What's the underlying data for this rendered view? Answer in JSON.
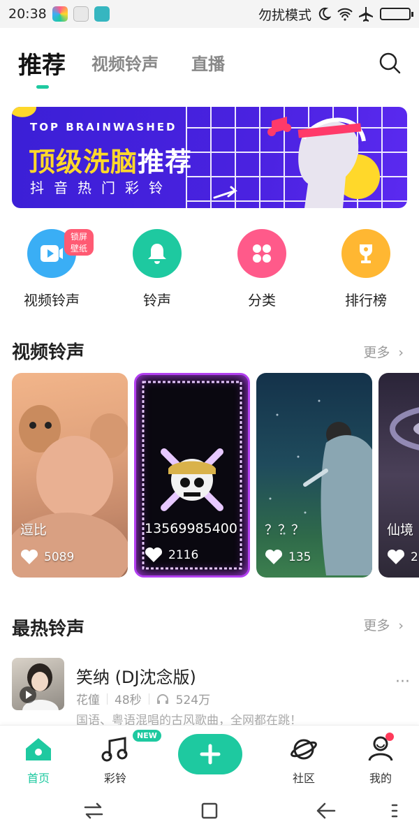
{
  "status": {
    "time": "20:38",
    "dnd_text": "勿扰模式",
    "icons": [
      "moon-icon",
      "wifi-icon",
      "airplane-icon",
      "battery-icon"
    ]
  },
  "top_tabs": [
    {
      "label": "推荐",
      "active": true
    },
    {
      "label": "视频铃声",
      "active": false
    },
    {
      "label": "直播",
      "active": false
    }
  ],
  "banner": {
    "en": "TOP BRAINWASHED",
    "title_yellow": "顶级洗脑",
    "title_white": "推荐",
    "subtitle": "抖音热门彩铃"
  },
  "quick": [
    {
      "label": "视频铃声",
      "icon": "video-play-icon",
      "color": "#3aaef5",
      "badge": "锁屏壁纸"
    },
    {
      "label": "铃声",
      "icon": "bell-icon",
      "color": "#1ec9a0"
    },
    {
      "label": "分类",
      "icon": "grid-icon",
      "color": "#ff5a8a"
    },
    {
      "label": "排行榜",
      "icon": "trophy-icon",
      "color": "#ffb732"
    }
  ],
  "video_section": {
    "title": "视频铃声",
    "more": "更多"
  },
  "videos": [
    {
      "title": "逗比",
      "likes": "5089"
    },
    {
      "title": "13569985400",
      "likes": "2116"
    },
    {
      "title": "？？？",
      "likes": "135"
    },
    {
      "title": "仙境",
      "likes": "2"
    }
  ],
  "hot_section": {
    "title": "最热铃声",
    "more": "更多"
  },
  "song": {
    "title": "笑纳 (DJ沈念版)",
    "artist": "花僮",
    "duration": "48秒",
    "plays": "524万",
    "desc": "国语、粤语混唱的古风歌曲，全网都在跳！"
  },
  "bottom_tabs": [
    {
      "label": "首页",
      "icon": "home-icon",
      "active": true
    },
    {
      "label": "彩铃",
      "icon": "music-note-icon",
      "badge": "NEW"
    },
    {
      "label": "",
      "icon": "plus-icon"
    },
    {
      "label": "社区",
      "icon": "planet-icon"
    },
    {
      "label": "我的",
      "icon": "user-icon",
      "dot": true
    }
  ],
  "colors": {
    "accent": "#1ec9a0",
    "banner": "#4a22e0",
    "banner_text": "#ffd82a"
  }
}
